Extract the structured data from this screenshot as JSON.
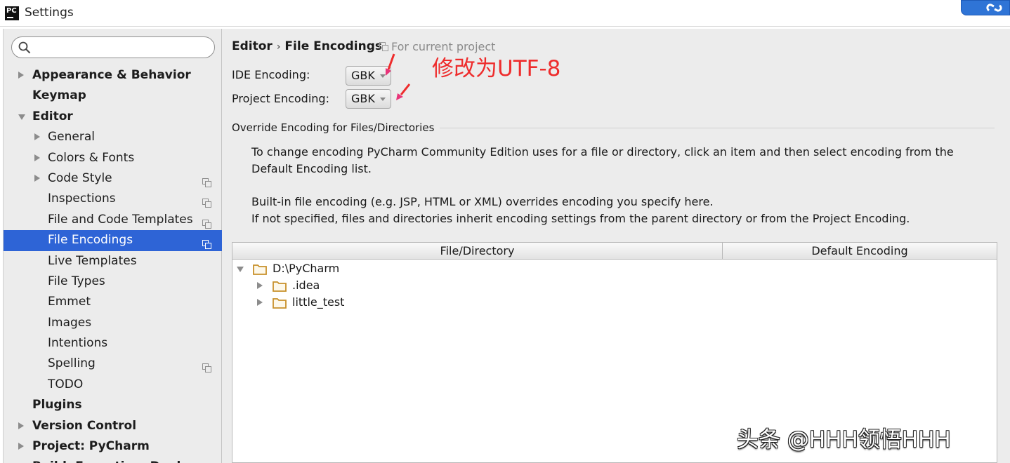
{
  "window": {
    "title": "Settings",
    "app_icon_text": "PC"
  },
  "search": {
    "placeholder": "",
    "value": ""
  },
  "sidebar": {
    "items": [
      {
        "label": "Appearance & Behavior",
        "level": 0,
        "bold": true,
        "arrow": "right",
        "copy": false,
        "selected": false
      },
      {
        "label": "Keymap",
        "level": 0,
        "bold": true,
        "arrow": "none",
        "copy": false,
        "selected": false
      },
      {
        "label": "Editor",
        "level": 0,
        "bold": true,
        "arrow": "down",
        "copy": false,
        "selected": false
      },
      {
        "label": "General",
        "level": 1,
        "bold": false,
        "arrow": "right",
        "copy": false,
        "selected": false
      },
      {
        "label": "Colors & Fonts",
        "level": 1,
        "bold": false,
        "arrow": "right",
        "copy": false,
        "selected": false
      },
      {
        "label": "Code Style",
        "level": 1,
        "bold": false,
        "arrow": "right",
        "copy": true,
        "selected": false
      },
      {
        "label": "Inspections",
        "level": 1,
        "bold": false,
        "arrow": "none",
        "copy": true,
        "selected": false
      },
      {
        "label": "File and Code Templates",
        "level": 1,
        "bold": false,
        "arrow": "none",
        "copy": true,
        "selected": false
      },
      {
        "label": "File Encodings",
        "level": 1,
        "bold": false,
        "arrow": "none",
        "copy": true,
        "selected": true
      },
      {
        "label": "Live Templates",
        "level": 1,
        "bold": false,
        "arrow": "none",
        "copy": false,
        "selected": false
      },
      {
        "label": "File Types",
        "level": 1,
        "bold": false,
        "arrow": "none",
        "copy": false,
        "selected": false
      },
      {
        "label": "Emmet",
        "level": 1,
        "bold": false,
        "arrow": "none",
        "copy": false,
        "selected": false
      },
      {
        "label": "Images",
        "level": 1,
        "bold": false,
        "arrow": "none",
        "copy": false,
        "selected": false
      },
      {
        "label": "Intentions",
        "level": 1,
        "bold": false,
        "arrow": "none",
        "copy": false,
        "selected": false
      },
      {
        "label": "Spelling",
        "level": 1,
        "bold": false,
        "arrow": "none",
        "copy": true,
        "selected": false
      },
      {
        "label": "TODO",
        "level": 1,
        "bold": false,
        "arrow": "none",
        "copy": false,
        "selected": false
      },
      {
        "label": "Plugins",
        "level": 0,
        "bold": true,
        "arrow": "none",
        "copy": false,
        "selected": false
      },
      {
        "label": "Version Control",
        "level": 0,
        "bold": true,
        "arrow": "right",
        "copy": false,
        "selected": false
      },
      {
        "label": "Project: PyCharm",
        "level": 0,
        "bold": true,
        "arrow": "right",
        "copy": false,
        "selected": false
      },
      {
        "label": "Build, Execution, Deployment",
        "level": 0,
        "bold": true,
        "arrow": "right",
        "copy": false,
        "selected": false
      }
    ]
  },
  "main": {
    "breadcrumb": {
      "parent": "Editor",
      "separator": "›",
      "current": "File Encodings"
    },
    "scope": "For current project",
    "ide_encoding": {
      "label": "IDE Encoding:",
      "value": "GBK"
    },
    "project_encoding": {
      "label": "Project Encoding:",
      "value": "GBK"
    },
    "annotation": "修改为UTF-8",
    "section_title": "Override Encoding for Files/Directories",
    "description": [
      "To change encoding PyCharm Community Edition uses for a file or directory, click an item and then select encoding from the",
      "Default Encoding list.",
      "Built-in file encoding (e.g. JSP, HTML or XML) overrides encoding you specify here.",
      "If not specified, files and directories inherit encoding settings from the parent directory or from the Project Encoding."
    ],
    "table": {
      "columns": [
        "File/Directory",
        "Default Encoding"
      ],
      "rows": [
        {
          "name": "D:\\PyCharm",
          "depth": 0,
          "expanded": true
        },
        {
          "name": ".idea",
          "depth": 1,
          "expanded": false
        },
        {
          "name": "little_test",
          "depth": 1,
          "expanded": false
        }
      ]
    }
  },
  "watermark": "头条 @HHH领悟HHH",
  "colors": {
    "selection": "#2e64d6",
    "annotation": "#ee2c2c",
    "folder": "#c8902a"
  }
}
